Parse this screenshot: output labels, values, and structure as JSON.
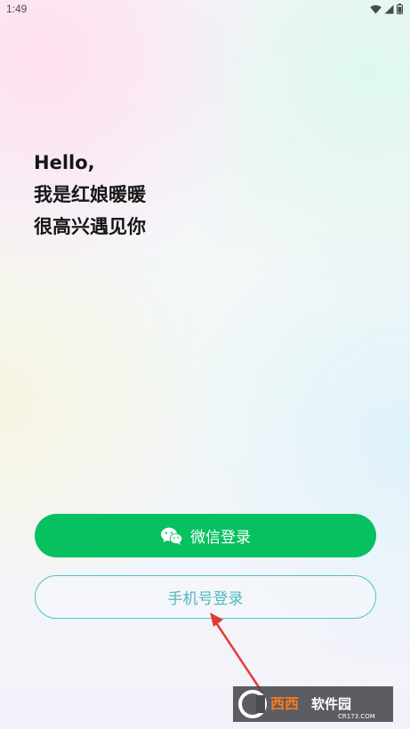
{
  "status_bar": {
    "time": "1:49",
    "icons": [
      "wifi-icon",
      "signal-icon",
      "battery-icon"
    ]
  },
  "greeting": {
    "line1": "Hello,",
    "line2": "我是红娘暖暖",
    "line3": "很高兴遇见你"
  },
  "buttons": {
    "wechat_label": "微信登录",
    "wechat_icon": "wechat-icon",
    "phone_label": "手机号登录"
  },
  "watermark": {
    "brand": "西西软件园",
    "site": "CR173.COM"
  },
  "colors": {
    "wechat_green": "#07c160",
    "phone_teal": "#4fc3c3",
    "arrow_red": "#e53935"
  }
}
